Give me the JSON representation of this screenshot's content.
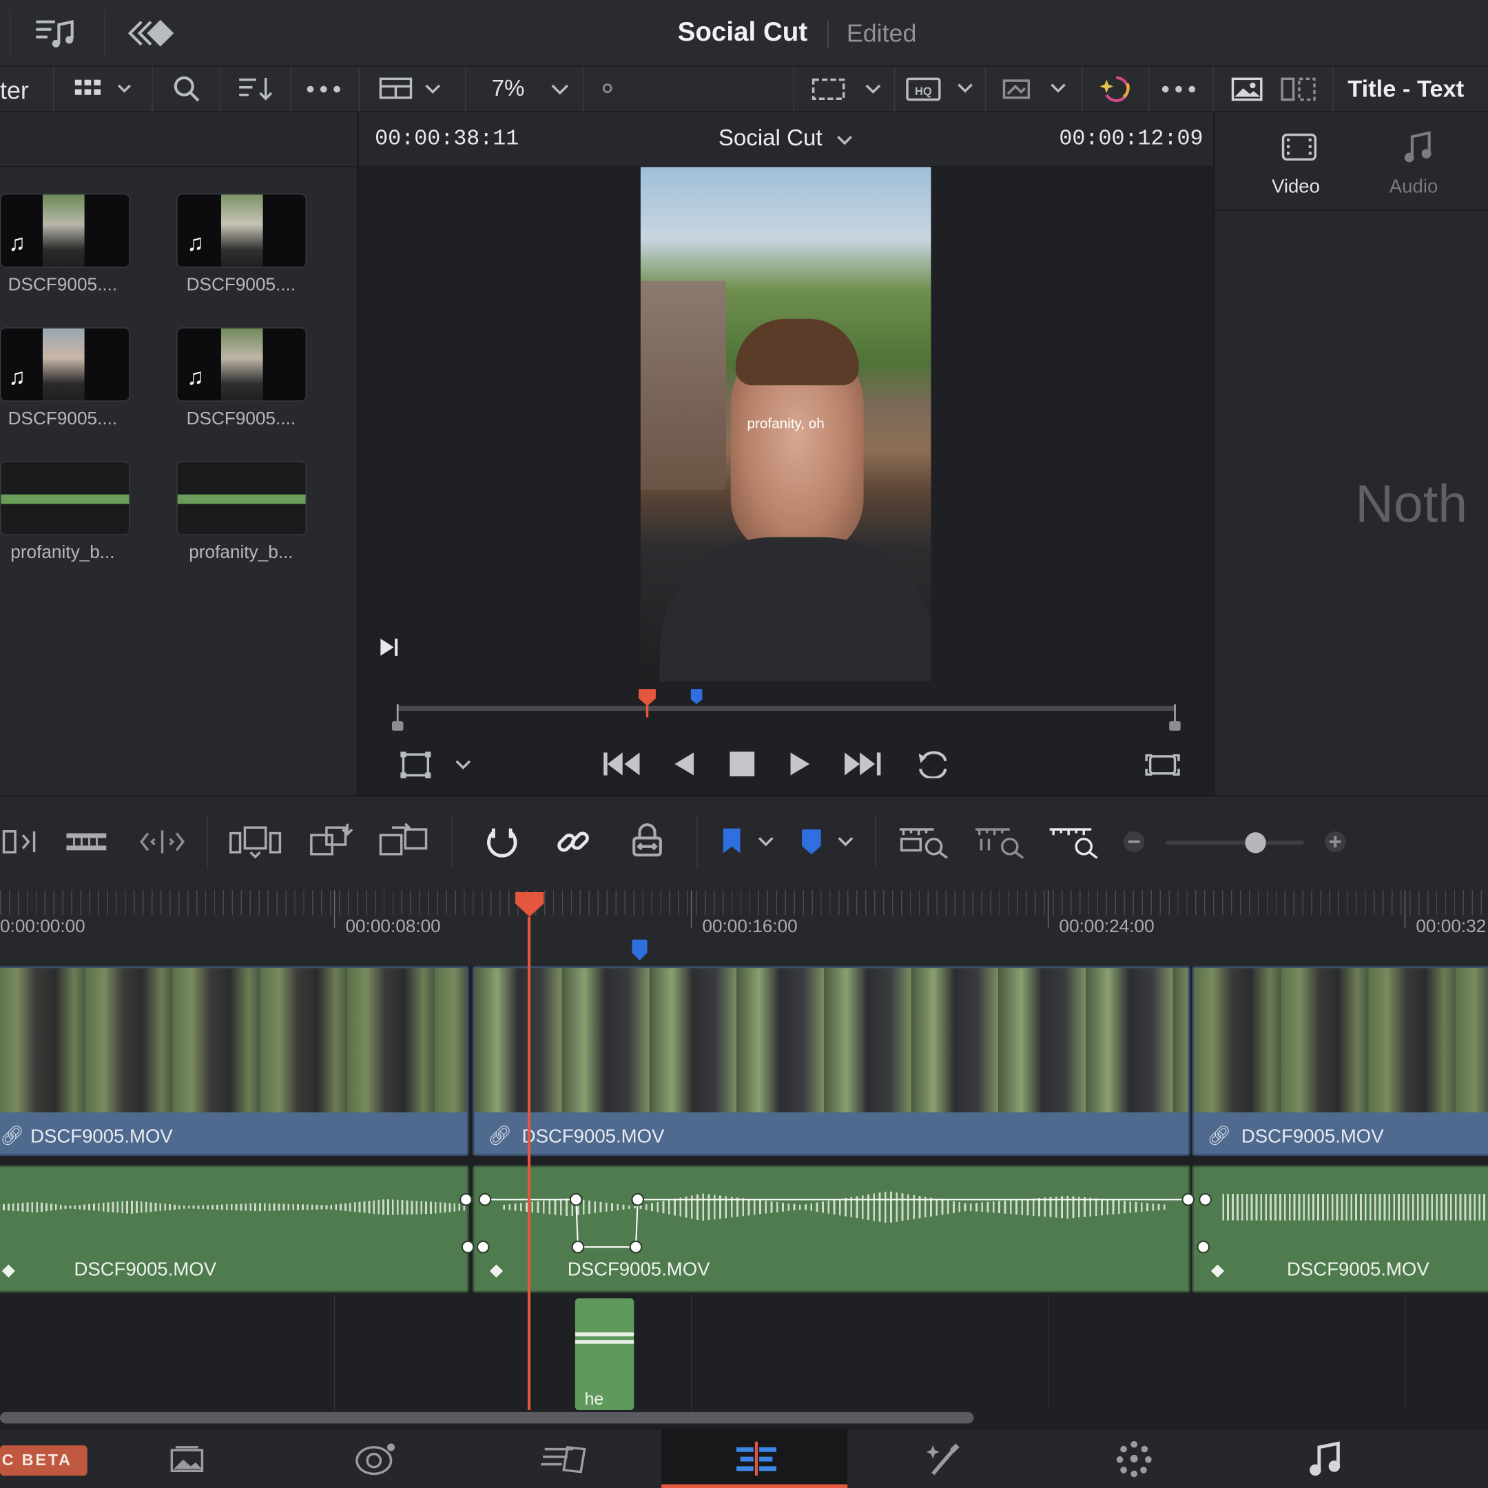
{
  "app": {
    "project_title": "Social Cut",
    "status": "Edited"
  },
  "toolbar": {
    "filter_label": "ter",
    "zoom": "7%"
  },
  "inspector": {
    "title": "Title - Text",
    "tabs": [
      "Video",
      "Audio"
    ],
    "empty_text": "Noth"
  },
  "media_pool": {
    "clips": [
      "DSCF9005....",
      "DSCF9005....",
      "DSCF9005....",
      "DSCF9005....",
      "profanity_b...",
      "profanity_b..."
    ]
  },
  "viewer": {
    "timecode_left": "00:00:38:11",
    "timeline_name": "Social Cut",
    "timecode_right": "00:00:12:09",
    "subtitle": "profanity, oh"
  },
  "timeline": {
    "ruler_labels": [
      "0:00:00:00",
      "00:00:08:00",
      "00:00:16:00",
      "00:00:24:00",
      "00:00:32"
    ],
    "video_clips": [
      "DSCF9005.MOV",
      "DSCF9005.MOV",
      "DSCF9005.MOV"
    ],
    "audio_clips": [
      "DSCF9005.MOV",
      "DSCF9005.MOV",
      "DSCF9005.MOV"
    ],
    "subtitle_clip": "he"
  },
  "bottom_nav": {
    "badge": "C BETA",
    "active": "edit-page"
  },
  "colors": {
    "playhead": "#e5573d",
    "marker": "#2f6fe0",
    "video_clip": "#4f6a8e",
    "audio_clip": "#4f7b4e",
    "accent": "#e5573d"
  }
}
